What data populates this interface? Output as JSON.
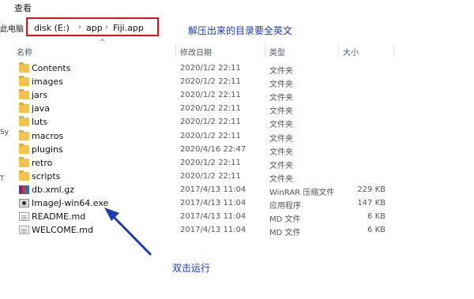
{
  "menu": {
    "view_label": "查看"
  },
  "nav_fragment": "此电脑",
  "address": {
    "crumbs": [
      "disk (E:)",
      "app",
      "Fiji.app"
    ]
  },
  "annotations": {
    "top_note": "解压出来的目录要全英文",
    "arrow_note": "双击运行",
    "color": "#1b3bb3",
    "highlight_color": "#e0101a"
  },
  "columns": {
    "name": "名称",
    "date": "修改日期",
    "type": "类型",
    "size": "大小"
  },
  "left_edge_fragments": [
    "Sy",
    "T"
  ],
  "files": [
    {
      "name": "Contents",
      "date": "2020/1/2 22:11",
      "type": "文件夹",
      "size": "",
      "icon": "folder-icon"
    },
    {
      "name": "images",
      "date": "2020/1/2 22:11",
      "type": "文件夹",
      "size": "",
      "icon": "folder-icon"
    },
    {
      "name": "jars",
      "date": "2020/1/2 22:11",
      "type": "文件夹",
      "size": "",
      "icon": "folder-icon"
    },
    {
      "name": "java",
      "date": "2020/1/2 22:11",
      "type": "文件夹",
      "size": "",
      "icon": "folder-icon"
    },
    {
      "name": "luts",
      "date": "2020/1/2 22:11",
      "type": "文件夹",
      "size": "",
      "icon": "folder-icon"
    },
    {
      "name": "macros",
      "date": "2020/1/2 22:11",
      "type": "文件夹",
      "size": "",
      "icon": "folder-icon"
    },
    {
      "name": "plugins",
      "date": "2020/4/16 22:47",
      "type": "文件夹",
      "size": "",
      "icon": "folder-icon"
    },
    {
      "name": "retro",
      "date": "2020/1/2 22:11",
      "type": "文件夹",
      "size": "",
      "icon": "folder-icon"
    },
    {
      "name": "scripts",
      "date": "2020/1/2 22:11",
      "type": "文件夹",
      "size": "",
      "icon": "folder-icon"
    },
    {
      "name": "db.xml.gz",
      "date": "2017/4/13 11:04",
      "type": "WinRAR 压缩文件",
      "size": "229 KB",
      "icon": "winrar-archive-icon"
    },
    {
      "name": "ImageJ-win64.exe",
      "date": "2017/4/13 11:04",
      "type": "应用程序",
      "size": "147 KB",
      "icon": "application-icon"
    },
    {
      "name": "README.md",
      "date": "2017/4/13 11:04",
      "type": "MD 文件",
      "size": "6 KB",
      "icon": "document-icon"
    },
    {
      "name": "WELCOME.md",
      "date": "2017/4/13 11:04",
      "type": "MD 文件",
      "size": "6 KB",
      "icon": "document-icon"
    }
  ]
}
